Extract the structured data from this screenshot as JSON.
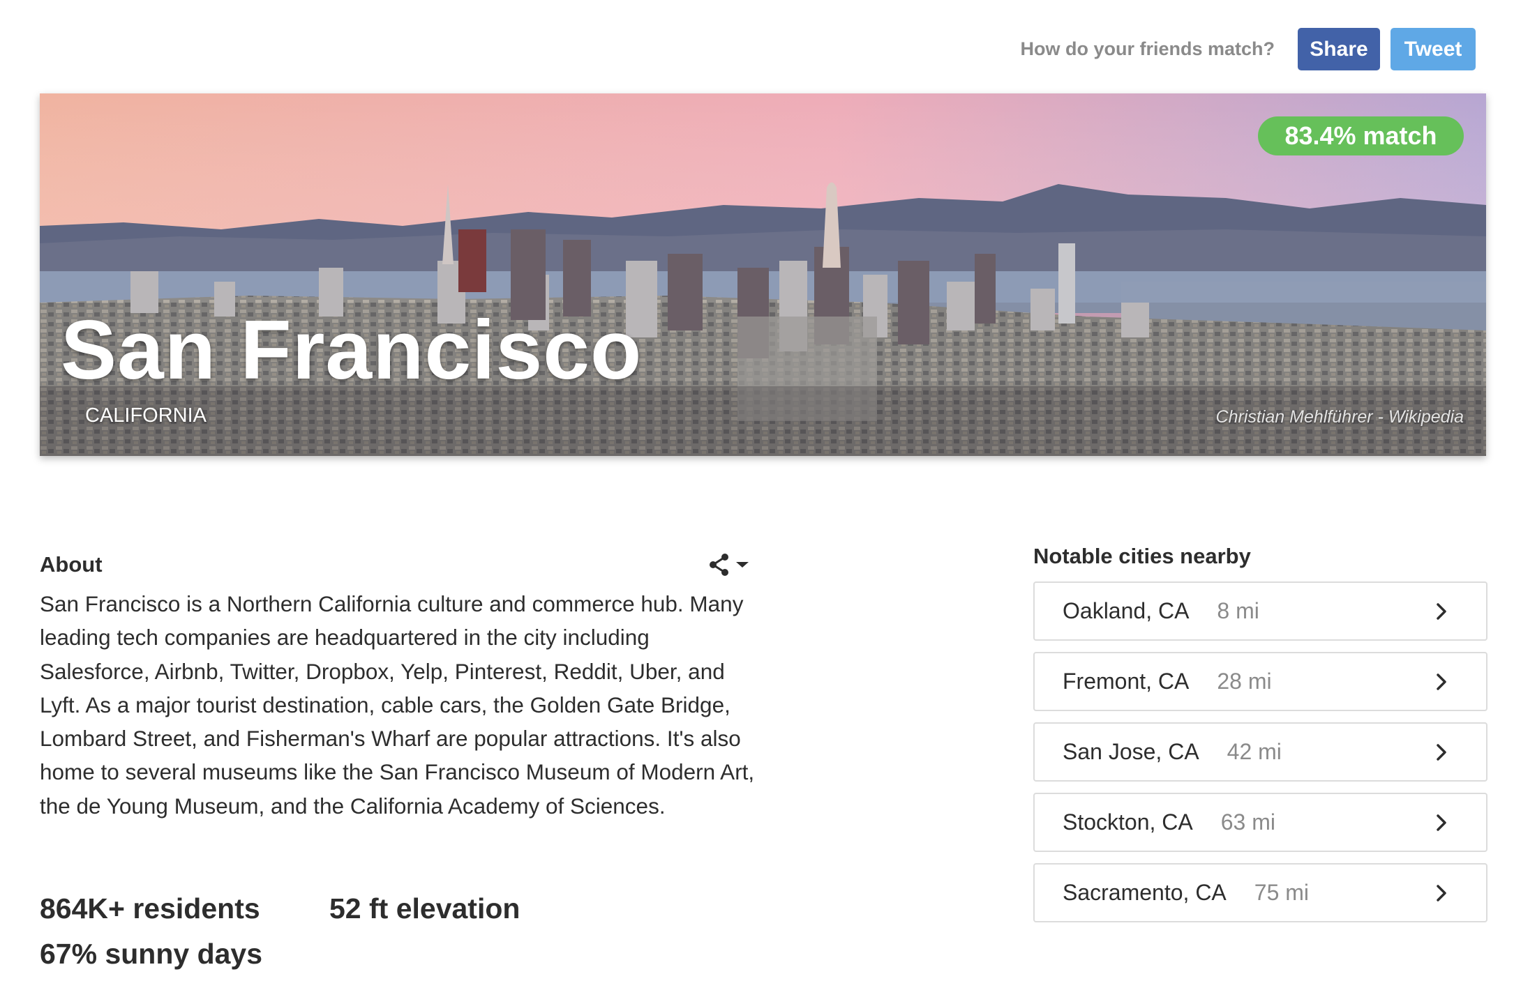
{
  "topbar": {
    "prompt": "How do your friends match?",
    "share_label": "Share",
    "tweet_label": "Tweet",
    "share_color": "#4262a8",
    "tweet_color": "#5fa8e6"
  },
  "hero": {
    "match_label": "83.4% match",
    "city": "San Francisco",
    "state": "CALIFORNIA",
    "credit": "Christian Mehlführer - Wikipedia",
    "badge_color": "#66c05a"
  },
  "about": {
    "title": "About",
    "share_icon": "share-icon",
    "text": "San Francisco is a Northern California culture and commerce hub. Many leading tech companies are headquartered in the city including Salesforce, Airbnb, Twitter, Dropbox, Yelp, Pinterest, Reddit, Uber, and Lyft. As a major tourist destination, cable cars, the Golden Gate Bridge, Lombard Street, and Fisherman's Wharf are popular attractions. It's also home to several museums like the San Francisco Museum of Modern Art, the de Young Museum, and the California Academy of Sciences."
  },
  "stats": {
    "residents": "864K+ residents",
    "elevation": "52 ft elevation",
    "sunny": "67% sunny days"
  },
  "nearby": {
    "title": "Notable cities nearby",
    "items": [
      {
        "name": "Oakland, CA",
        "distance": "8 mi"
      },
      {
        "name": "Fremont, CA",
        "distance": "28 mi"
      },
      {
        "name": "San Jose, CA",
        "distance": "42 mi"
      },
      {
        "name": "Stockton, CA",
        "distance": "63 mi"
      },
      {
        "name": "Sacramento, CA",
        "distance": "75 mi"
      }
    ]
  }
}
